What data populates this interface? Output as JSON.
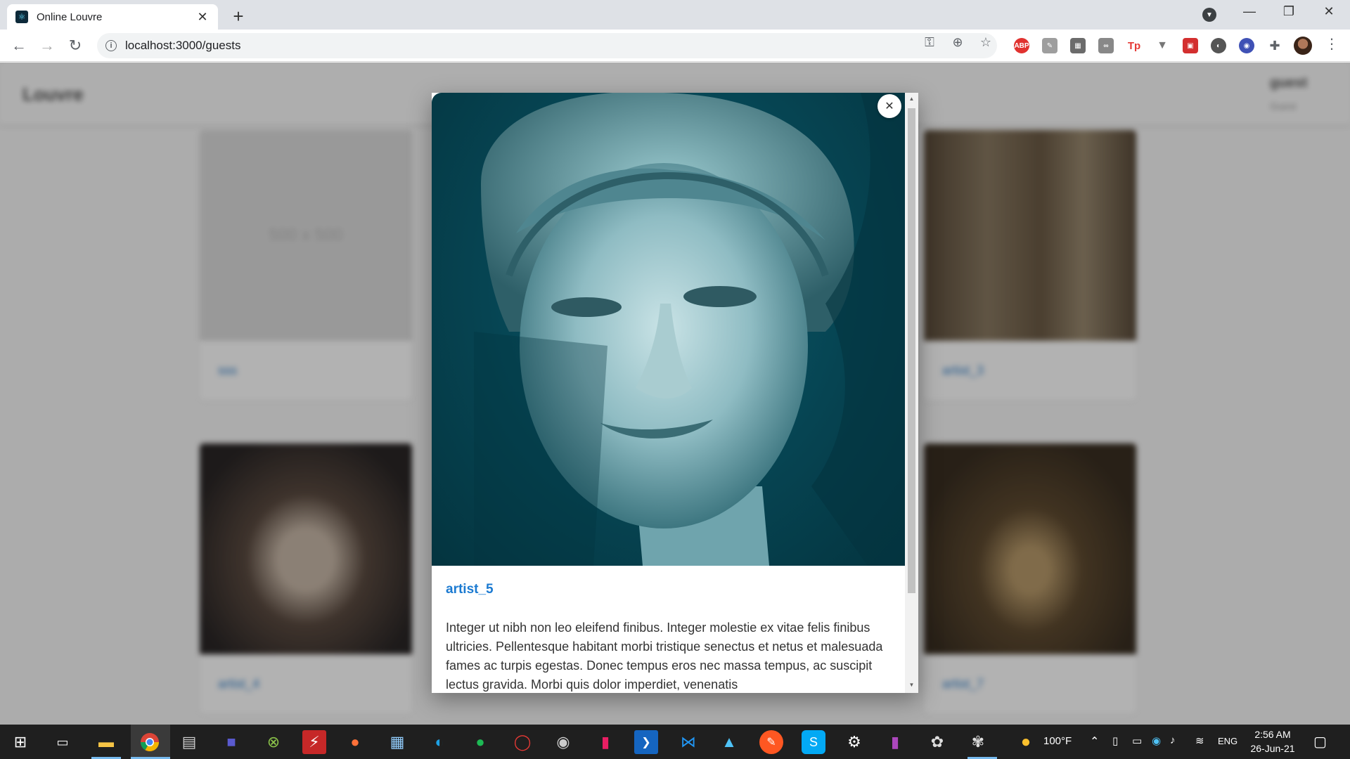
{
  "browser": {
    "tab_title": "Online Louvre",
    "url": "localhost:3000/guests",
    "extensions": [
      "ABP",
      "Tp"
    ]
  },
  "app": {
    "brand": "Louvre",
    "user_name": "guest",
    "user_role": "Guest"
  },
  "cards": [
    {
      "caption": "sss",
      "placeholder": "500 x 500"
    },
    {
      "caption": "artist_3"
    },
    {
      "caption": "artist_4"
    },
    {
      "caption": "artist_7"
    }
  ],
  "modal": {
    "title": "artist_5",
    "description": "Integer ut nibh non leo eleifend finibus. Integer molestie ex vitae felis finibus ultricies. Pellentesque habitant morbi tristique senectus et netus et malesuada fames ac turpis egestas. Donec tempus eros nec massa tempus, ac suscipit lectus gravida. Morbi quis dolor imperdiet, venenatis"
  },
  "taskbar": {
    "temperature": "100°F",
    "language": "ENG",
    "time": "2:56 AM",
    "date": "26-Jun-21"
  }
}
